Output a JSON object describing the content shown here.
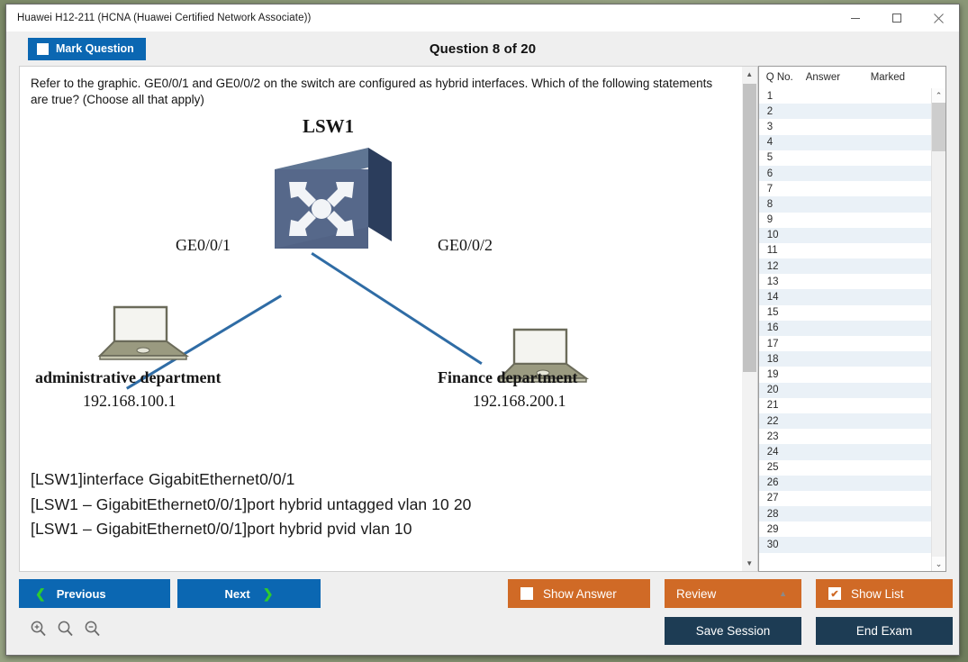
{
  "window": {
    "title": "Huawei H12-211 (HCNA (Huawei Certified Network Associate))",
    "minimize_label": "minimize-icon",
    "maximize_label": "maximize-icon",
    "close_label": "close-icon"
  },
  "topbar": {
    "mark_question_label": "Mark Question",
    "question_title": "Question 8 of 20"
  },
  "question": {
    "text": "Refer to the graphic. GE0/0/1 and GE0/0/2 on the switch are configured as hybrid interfaces. Which of the following statements are true? (Choose all that apply)",
    "diagram": {
      "switch_name": "LSW1",
      "port_left": "GE0/0/1",
      "port_right": "GE0/0/2",
      "host_left_name": "administrative department",
      "host_left_ip": "192.168.100.1",
      "host_right_name": "Finance department",
      "host_right_ip": "192.168.200.1"
    },
    "cli_lines": [
      "[LSW1]interface GigabitEthernet0/0/1",
      "[LSW1 – GigabitEthernet0/0/1]port hybrid untagged vlan 10 20",
      "[LSW1 – GigabitEthernet0/0/1]port hybrid pvid vlan 10"
    ]
  },
  "list": {
    "columns": [
      "Q No.",
      "Answer",
      "Marked"
    ],
    "rows": [
      {
        "no": "1",
        "answer": "",
        "marked": ""
      },
      {
        "no": "2",
        "answer": "",
        "marked": ""
      },
      {
        "no": "3",
        "answer": "",
        "marked": ""
      },
      {
        "no": "4",
        "answer": "",
        "marked": ""
      },
      {
        "no": "5",
        "answer": "",
        "marked": ""
      },
      {
        "no": "6",
        "answer": "",
        "marked": ""
      },
      {
        "no": "7",
        "answer": "",
        "marked": ""
      },
      {
        "no": "8",
        "answer": "",
        "marked": ""
      },
      {
        "no": "9",
        "answer": "",
        "marked": ""
      },
      {
        "no": "10",
        "answer": "",
        "marked": ""
      },
      {
        "no": "11",
        "answer": "",
        "marked": ""
      },
      {
        "no": "12",
        "answer": "",
        "marked": ""
      },
      {
        "no": "13",
        "answer": "",
        "marked": ""
      },
      {
        "no": "14",
        "answer": "",
        "marked": ""
      },
      {
        "no": "15",
        "answer": "",
        "marked": ""
      },
      {
        "no": "16",
        "answer": "",
        "marked": ""
      },
      {
        "no": "17",
        "answer": "",
        "marked": ""
      },
      {
        "no": "18",
        "answer": "",
        "marked": ""
      },
      {
        "no": "19",
        "answer": "",
        "marked": ""
      },
      {
        "no": "20",
        "answer": "",
        "marked": ""
      },
      {
        "no": "21",
        "answer": "",
        "marked": ""
      },
      {
        "no": "22",
        "answer": "",
        "marked": ""
      },
      {
        "no": "23",
        "answer": "",
        "marked": ""
      },
      {
        "no": "24",
        "answer": "",
        "marked": ""
      },
      {
        "no": "25",
        "answer": "",
        "marked": ""
      },
      {
        "no": "26",
        "answer": "",
        "marked": ""
      },
      {
        "no": "27",
        "answer": "",
        "marked": ""
      },
      {
        "no": "28",
        "answer": "",
        "marked": ""
      },
      {
        "no": "29",
        "answer": "",
        "marked": ""
      },
      {
        "no": "30",
        "answer": "",
        "marked": ""
      }
    ]
  },
  "footer": {
    "previous_label": "Previous",
    "next_label": "Next",
    "show_answer_label": "Show Answer",
    "review_label": "Review",
    "show_list_label": "Show List",
    "show_list_check": "✔",
    "save_session_label": "Save Session",
    "end_exam_label": "End Exam",
    "zoom_in_label": "zoom-in-icon",
    "zoom_reset_label": "zoom-icon",
    "zoom_out_label": "zoom-out-icon"
  },
  "colors": {
    "accent_blue": "#0b67b2",
    "accent_orange": "#d06a26",
    "accent_navy": "#1d3c54",
    "link_blue": "#2f6ca5",
    "chevron_green": "#2ecc2e"
  }
}
